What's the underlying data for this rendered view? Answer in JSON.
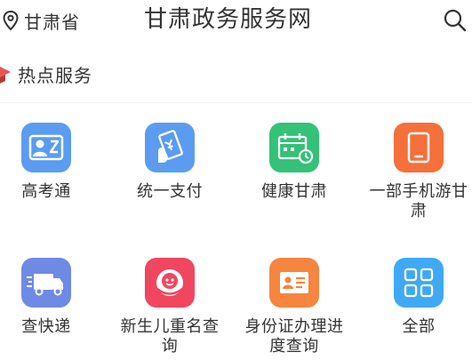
{
  "header": {
    "location": "甘肃省",
    "title": "甘肃政务服务网"
  },
  "section": {
    "title": "热点服务"
  },
  "services": [
    {
      "label": "高考通",
      "icon": "student-card-icon",
      "color": "#5b9cf1"
    },
    {
      "label": "统一支付",
      "icon": "payment-card-icon",
      "color": "#5b9cf1"
    },
    {
      "label": "健康甘肃",
      "icon": "health-calendar-icon",
      "color": "#35c177"
    },
    {
      "label": "一部手机游甘肃",
      "icon": "tablet-icon",
      "color": "#f5703a"
    },
    {
      "label": "查快递",
      "icon": "delivery-truck-icon",
      "color": "#6f8ae5"
    },
    {
      "label": "新生儿重名查询",
      "icon": "newborn-icon",
      "color": "#f0465f"
    },
    {
      "label": "身份证办理进度查询",
      "icon": "id-card-icon",
      "color": "#f5853f"
    },
    {
      "label": "全部",
      "icon": "all-grid-icon",
      "color": "#3fa9f5"
    }
  ]
}
